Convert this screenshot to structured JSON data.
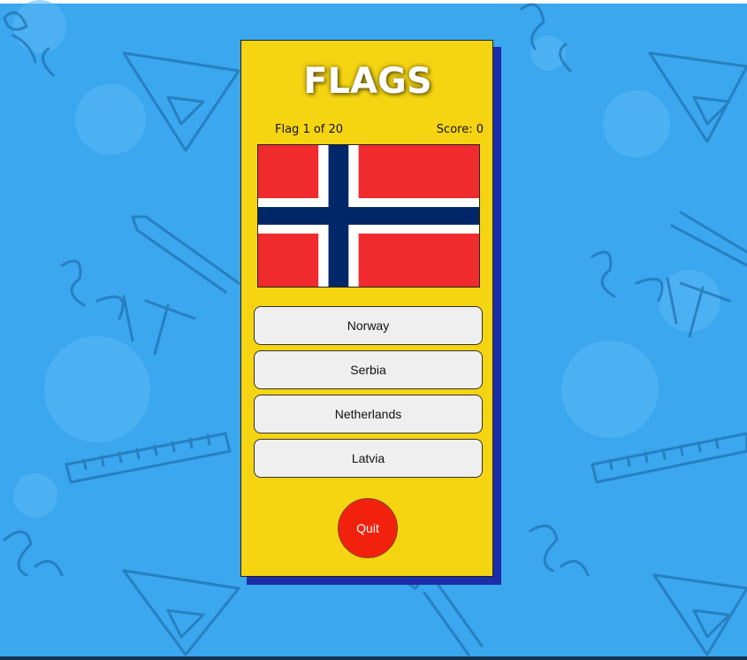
{
  "quiz": {
    "title": "FLAGS",
    "flag_counter": "Flag 1 of 20",
    "score": "Score: 0",
    "flag_image": "norway-flag",
    "answers": [
      {
        "label": "Norway"
      },
      {
        "label": "Serbia"
      },
      {
        "label": "Netherlands"
      },
      {
        "label": "Latvia"
      }
    ],
    "quit_label": "Quit"
  },
  "colors": {
    "background": "#3aa7ef",
    "card": "#f5d512",
    "card_shadow": "#1b2ea8",
    "quit_button": "#f2210e",
    "flag_red": "#ef2b2d",
    "flag_blue": "#002868",
    "flag_white": "#ffffff"
  }
}
